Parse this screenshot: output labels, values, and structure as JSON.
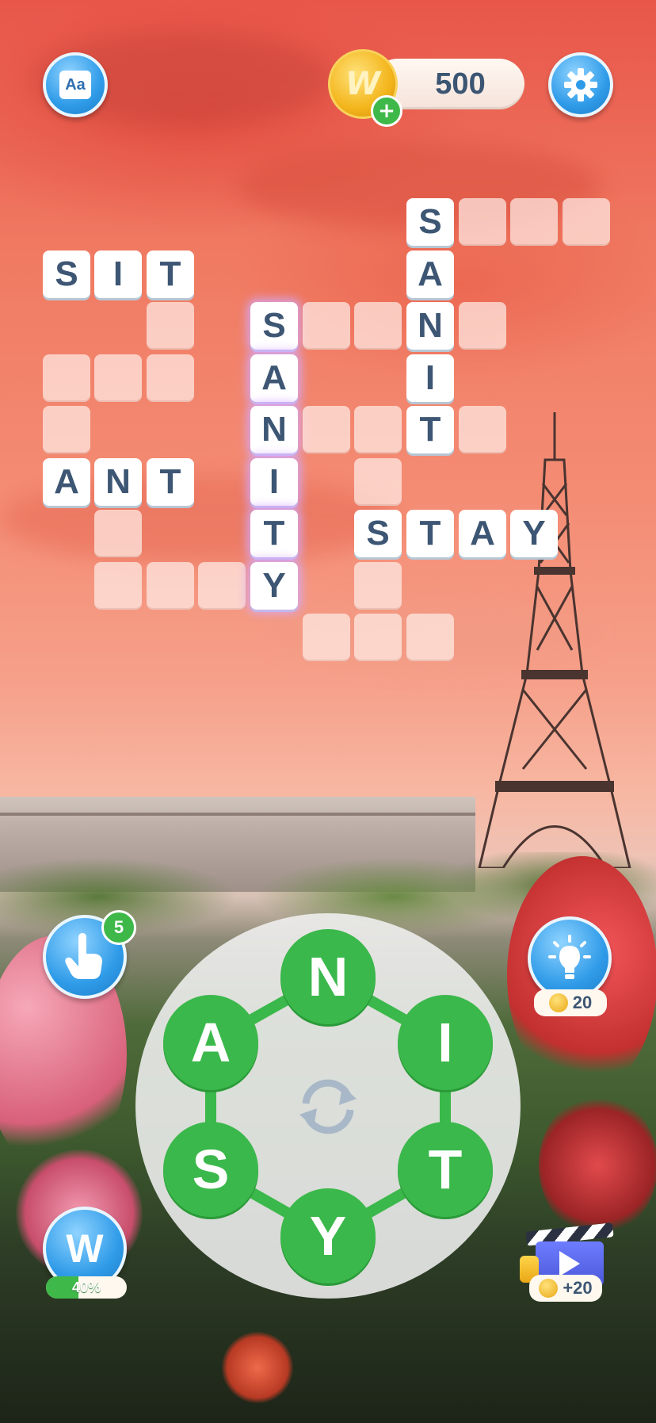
{
  "header": {
    "dictionary_icon_label": "Aa",
    "coin_symbol": "W",
    "coin_plus": "+",
    "coins": "500"
  },
  "puzzle": {
    "words_found": [
      "SIT",
      "ANT",
      "SANITY",
      "SANIT",
      "STAY"
    ],
    "letters": {
      "sit_s": "S",
      "sit_i": "I",
      "sit_t": "T",
      "ant_a": "A",
      "ant_n": "N",
      "ant_t": "T",
      "sanity_s": "S",
      "sanity_a": "A",
      "sanity_n": "N",
      "sanity_i": "I",
      "sanity_t": "T",
      "sanity_y": "Y",
      "sanit_s": "S",
      "sanit_a": "A",
      "sanit_n": "N",
      "sanit_i": "I",
      "sanit_t": "T",
      "stay_s": "S",
      "stay_t": "T",
      "stay_a": "A",
      "stay_y": "Y"
    }
  },
  "wheel": {
    "letters": [
      "N",
      "I",
      "T",
      "Y",
      "S",
      "A"
    ],
    "shuffle_icon": "shuffle-icon"
  },
  "boosters": {
    "finger_count": "5",
    "hint_cost": "20",
    "w_progress_label": "40%",
    "w_progress": 0.4,
    "w_symbol": "W",
    "video_reward": "+20"
  },
  "colors": {
    "tile_text": "#3d5674",
    "letter_green": "#3bb84b",
    "button_blue": "#2f9be8"
  }
}
